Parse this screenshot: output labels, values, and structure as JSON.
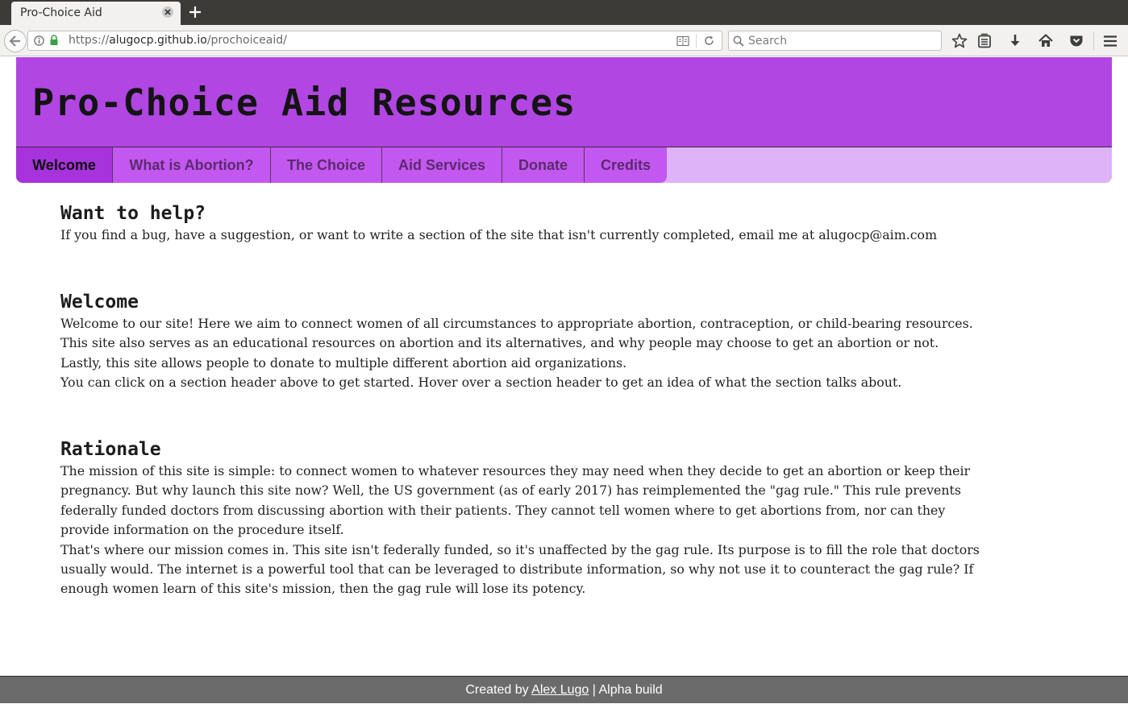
{
  "browser": {
    "tab_title": "Pro-Choice Aid",
    "url_scheme": "https://",
    "url_host": "alugocp.github.io",
    "url_path": "/prochoiceaid/",
    "search_placeholder": "Search"
  },
  "header": {
    "title": "Pro-Choice Aid Resources"
  },
  "nav": {
    "items": [
      {
        "label": "Welcome"
      },
      {
        "label": "What is Abortion?"
      },
      {
        "label": "The Choice"
      },
      {
        "label": "Aid Services"
      },
      {
        "label": "Donate"
      },
      {
        "label": "Credits"
      }
    ]
  },
  "content": {
    "help": {
      "heading": "Want to help?",
      "text": "If you find a bug, have a suggestion, or want to write a section of the site that isn't currently completed, email me at alugocp@aim.com"
    },
    "welcome": {
      "heading": "Welcome",
      "lines": [
        "Welcome to our site! Here we aim to connect women of all circumstances to appropriate abortion, contraception, or child-bearing resources.",
        "This site also serves as an educational resources on abortion and its alternatives, and why people may choose to get an abortion or not.",
        "Lastly, this site allows people to donate to multiple different abortion aid organizations.",
        "You can click on a section header above to get started. Hover over a section header to get an idea of what the section talks about."
      ]
    },
    "rationale": {
      "heading": "Rationale",
      "lines": [
        "The mission of this site is simple: to connect women to whatever resources they may need when they decide to get an abortion or keep their",
        "pregnancy. But why launch this site now? Well, the US government (as of early 2017) has reimplemented the \"gag rule.\" This rule prevents",
        "federally funded doctors from discussing abortion with their patients. They cannot tell women where to get abortions from, nor can they",
        "provide information on the procedure itself.",
        "That's where our mission comes in. This site isn't federally funded, so it's unaffected by the gag rule. Its purpose is to fill the role that doctors",
        "usually would. The internet is a powerful tool that can be leveraged to distribute information, so why not use it to counteract the gag rule? If",
        "enough women learn of this site's mission, then the gag rule will lose its potency."
      ]
    }
  },
  "footer": {
    "prefix": "Created by",
    "author": "Alex Lugo",
    "suffix": "| Alpha build"
  },
  "colors": {
    "header_bg": "#b146e3",
    "nav_active": "#a733dc",
    "nav_item": "#c358f0",
    "nav_bar": "#deb3f7",
    "footer_bg": "#6b6b6b"
  }
}
